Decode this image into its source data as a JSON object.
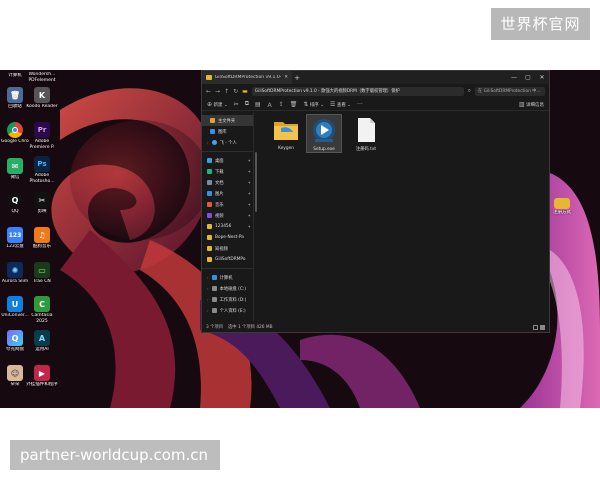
{
  "watermark_top": "世界杯官网",
  "watermark_bottom": "partner-worldcup.com.cn",
  "desktop": {
    "icons_col1": [
      {
        "label": "计算机",
        "icon": "computer-icon",
        "color": "#3a6fd0",
        "glyph": ""
      },
      {
        "label": "回收站",
        "icon": "recycle-bin-icon",
        "color": "#5a7fb0",
        "glyph": ""
      },
      {
        "label": "Google Chrome",
        "icon": "chrome-icon",
        "color": "#d93025",
        "glyph": "●"
      },
      {
        "label": "微信",
        "icon": "wechat-icon",
        "color": "#2aae67",
        "glyph": "✉"
      },
      {
        "label": "QQ",
        "icon": "qq-icon",
        "color": "#1e1e1e",
        "glyph": "Q"
      },
      {
        "label": "123云盘",
        "icon": "cloud-drive-icon",
        "color": "#3b82f6",
        "glyph": "123"
      },
      {
        "label": "Aurora Slim",
        "icon": "aurora-icon",
        "color": "#0d2a5a",
        "glyph": "A"
      },
      {
        "label": "UniConver...",
        "icon": "uniconverter-icon",
        "color": "#0f7fe0",
        "glyph": "U"
      },
      {
        "label": "夸克网盘",
        "icon": "quark-icon",
        "color": "#6a5cf6",
        "glyph": "Q"
      },
      {
        "label": "朵朵",
        "icon": "avatar-app-icon",
        "color": "#c9a27a",
        "glyph": "☺"
      }
    ],
    "icons_col2": [
      {
        "label": "Wondersh... PDFelement",
        "icon": "pdfelement-icon",
        "color": "#2a5de0",
        "glyph": ""
      },
      {
        "label": "Koodo Reader",
        "icon": "koodo-reader-icon",
        "color": "#444444",
        "glyph": "K"
      },
      {
        "label": "Adobe Premiere P.",
        "icon": "premiere-icon",
        "color": "#2b0a4a",
        "glyph": "Pr"
      },
      {
        "label": "Adobe Photosho...",
        "icon": "photoshop-icon",
        "color": "#0a2340",
        "glyph": "Ps"
      },
      {
        "label": "剪映",
        "icon": "capcut-icon",
        "color": "#111111",
        "glyph": "✂"
      },
      {
        "label": "酷狗音乐",
        "icon": "kugou-icon",
        "color": "#f07a1a",
        "glyph": "K"
      },
      {
        "label": "Trae CN",
        "icon": "trae-icon",
        "color": "#1b3a1b",
        "glyph": "▭"
      },
      {
        "label": "Camtasia 2025",
        "icon": "camtasia-icon",
        "color": "#2e9a3a",
        "glyph": "C"
      },
      {
        "label": "运用AI",
        "icon": "ai-app-icon",
        "color": "#0b3a4a",
        "glyph": "A"
      },
      {
        "label": "外挂插件和程序",
        "icon": "plugin-app-icon",
        "color": "#c0264a",
        "glyph": "▶"
      }
    ],
    "icon_right": {
      "label": "注册方式",
      "icon": "folder-icon"
    }
  },
  "explorer": {
    "tab_title": "GiliSoftDRMProtection v9.1.0~",
    "new_tab": "+",
    "minimize": "—",
    "maximize": "▢",
    "close": "✕",
    "address": "GiliSoftDRMProtection v9.1.0 - 款强大的视频DRM（数字版权管理）保护",
    "search_placeholder": "在 GiliSoftDRMProtection 中...",
    "toolbar": {
      "new_label": "新建",
      "sort_label": "排序",
      "view_label": "查看",
      "details_label": "详细信息"
    },
    "nav_items": [
      {
        "label": "主文件夹",
        "icon": "home-icon",
        "color": "#e0a030",
        "selected": true
      },
      {
        "label": "图库",
        "icon": "gallery-icon",
        "color": "#3c8fe0"
      },
      {
        "label": "飞 - 个人",
        "icon": "cloud-icon",
        "color": "#4aa0e8"
      }
    ],
    "quick_items": [
      {
        "label": "桌面",
        "icon": "desktop-folder-icon",
        "color": "#3aa0d8",
        "pin": "✦"
      },
      {
        "label": "下载",
        "icon": "downloads-icon",
        "color": "#2ab080",
        "pin": "✦"
      },
      {
        "label": "文档",
        "icon": "documents-icon",
        "color": "#7a8aa0",
        "pin": "✦"
      },
      {
        "label": "图片",
        "icon": "pictures-icon",
        "color": "#3c8fe0",
        "pin": "✦"
      },
      {
        "label": "音乐",
        "icon": "music-icon",
        "color": "#e05a3a",
        "pin": "✦"
      },
      {
        "label": "视频",
        "icon": "videos-icon",
        "color": "#8a4ae0",
        "pin": "✦"
      },
      {
        "label": "123456",
        "icon": "folder-icon",
        "color": "#e8b731",
        "pin": "✦"
      },
      {
        "label": "Bope-Nest-Pa",
        "icon": "folder-icon",
        "color": "#e8b731",
        "pin": ""
      },
      {
        "label": "知视频",
        "icon": "folder-icon",
        "color": "#e8b731",
        "pin": ""
      },
      {
        "label": "GiliSoftDRMPo",
        "icon": "folder-icon",
        "color": "#e8b731",
        "pin": ""
      }
    ],
    "tree_items": [
      {
        "label": "计算机",
        "icon": "computer-icon",
        "color": "#3c8fe0"
      },
      {
        "label": "本地磁盘 (C:)",
        "icon": "drive-icon",
        "color": "#8a8a8a"
      },
      {
        "label": "工作资料 (D:)",
        "icon": "drive-icon",
        "color": "#8a8a8a"
      },
      {
        "label": "个人资料 (E:)",
        "icon": "drive-icon",
        "color": "#8a8a8a"
      }
    ],
    "files": [
      {
        "name": "Keygen",
        "icon": "folder-icon"
      },
      {
        "name": "Setup.exe",
        "icon": "setup-exe-icon"
      },
      {
        "name": "注册码.txt",
        "icon": "text-file-icon"
      }
    ],
    "status": {
      "count": "3 个项目",
      "selection": "选中 1 个项目 426 MB"
    }
  }
}
